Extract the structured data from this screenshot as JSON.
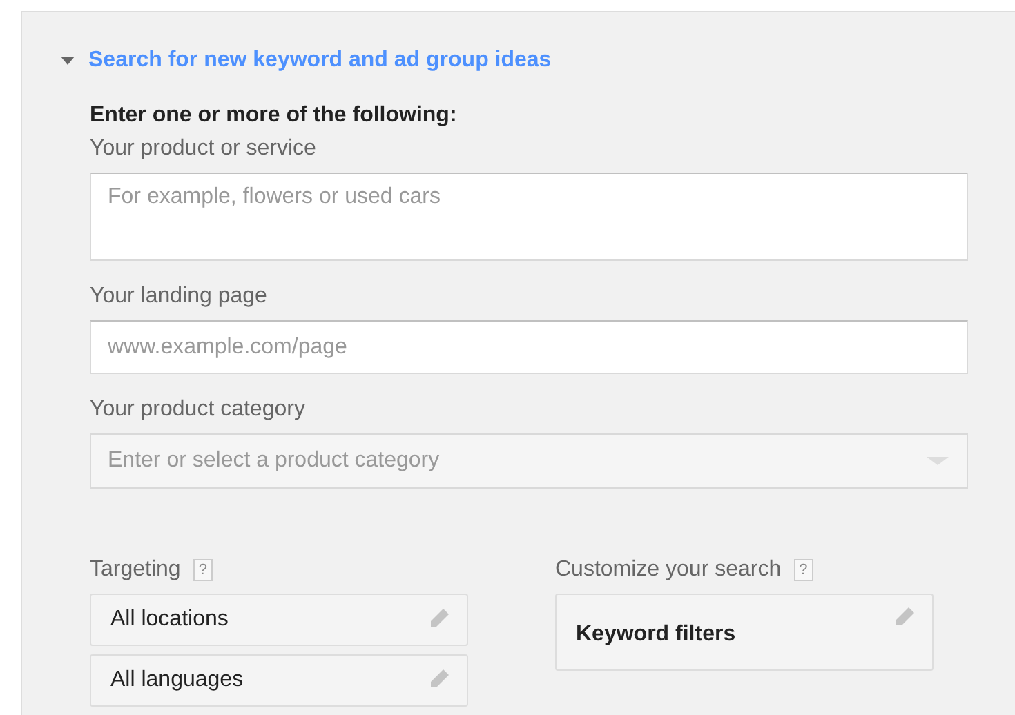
{
  "section": {
    "title": "Search for new keyword and ad group ideas",
    "expanded": true
  },
  "intro": "Enter one or more of the following:",
  "fields": [
    {
      "kind": "textarea",
      "label": "Your product or service",
      "placeholder": "For example, flowers or used cars"
    },
    {
      "kind": "input",
      "label": "Your landing page",
      "placeholder": "www.example.com/page"
    },
    {
      "kind": "combo",
      "label": "Your product category",
      "placeholder": "Enter or select a product category"
    }
  ],
  "columns": [
    {
      "title": "Targeting",
      "help": "?",
      "items": [
        {
          "label": "All locations",
          "bold": false
        },
        {
          "label": "All languages",
          "bold": false
        }
      ]
    },
    {
      "title": "Customize your search",
      "help": "?",
      "items": [
        {
          "label": "Keyword filters",
          "bold": true
        }
      ]
    }
  ]
}
